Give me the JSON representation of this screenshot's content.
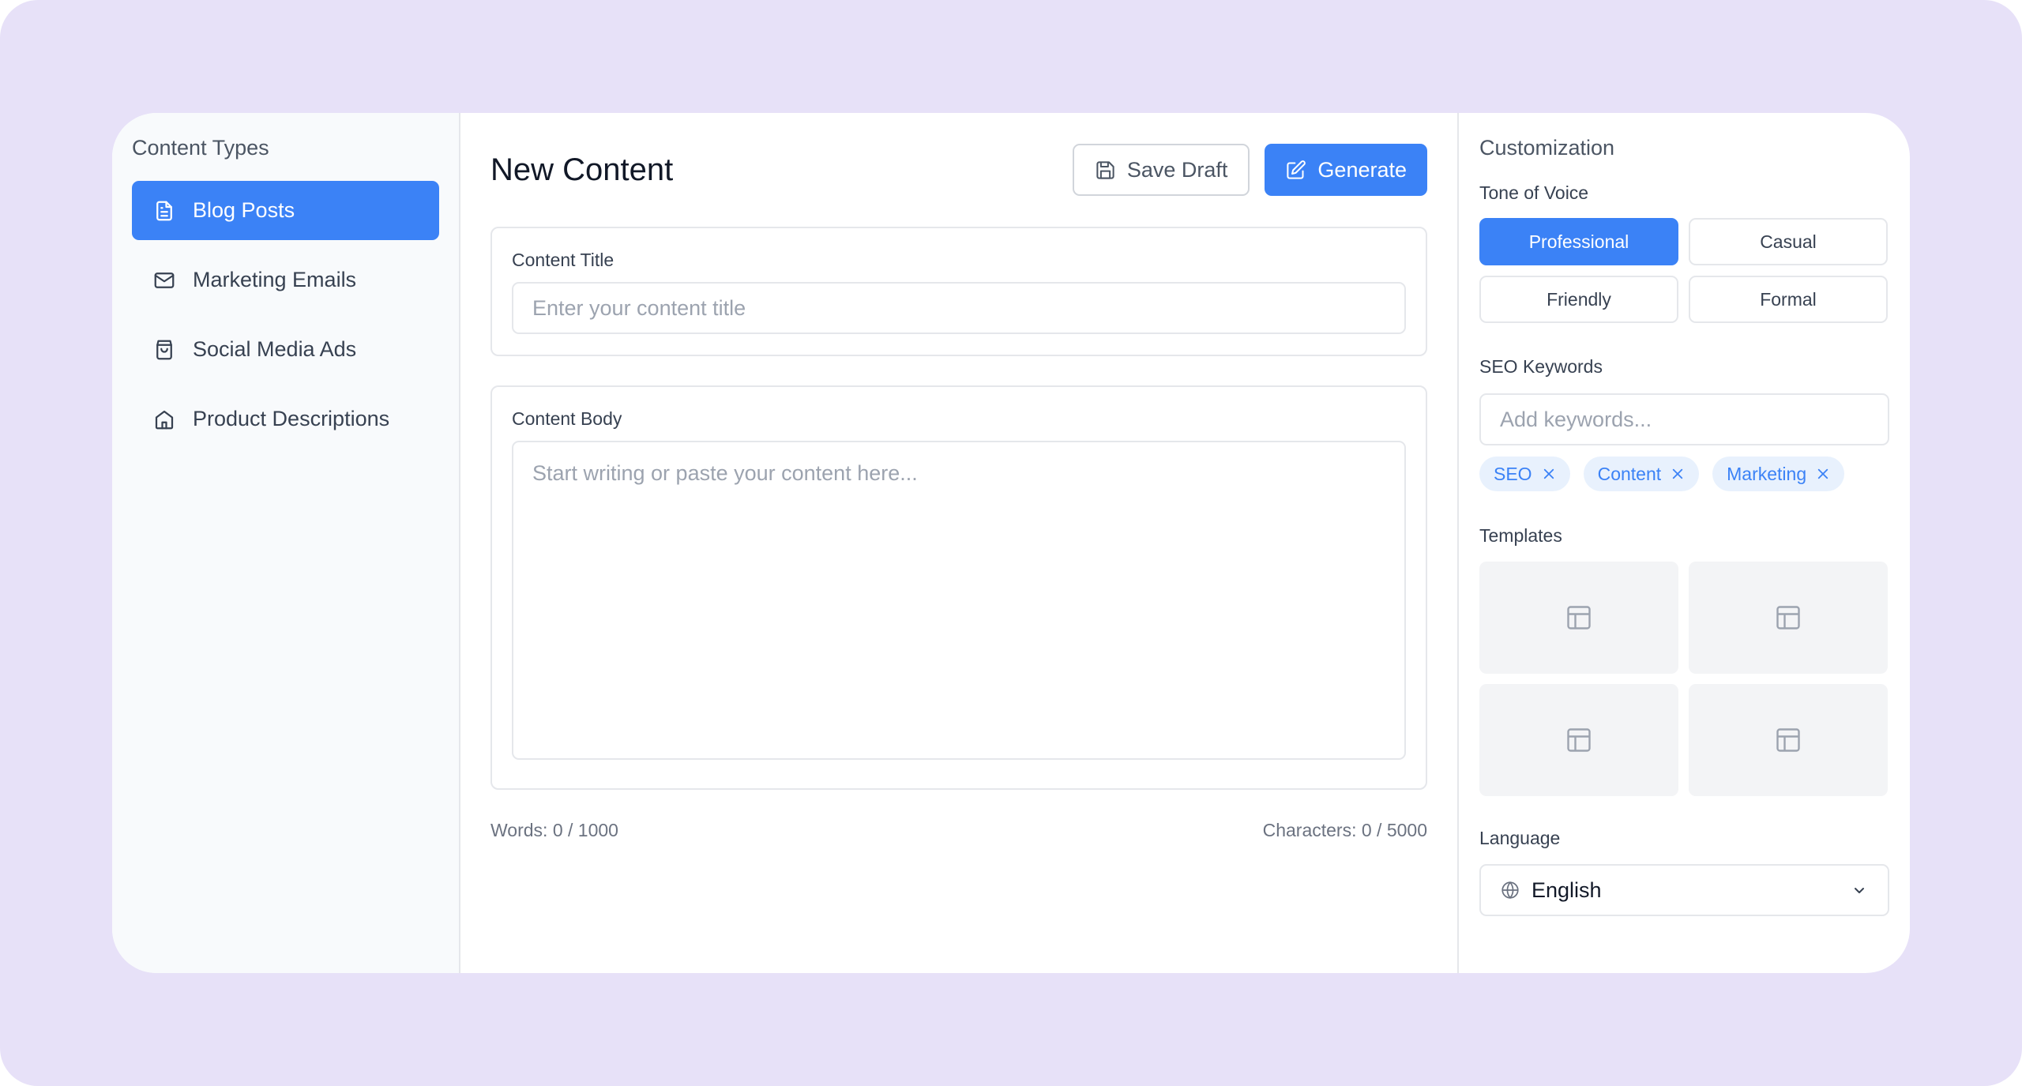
{
  "sidebar": {
    "title": "Content Types",
    "items": [
      {
        "label": "Blog Posts",
        "icon": "document-icon",
        "active": true
      },
      {
        "label": "Marketing Emails",
        "icon": "mail-icon",
        "active": false
      },
      {
        "label": "Social Media Ads",
        "icon": "shopping-bag-icon",
        "active": false
      },
      {
        "label": "Product Descriptions",
        "icon": "home-icon",
        "active": false
      }
    ]
  },
  "main": {
    "title": "New Content",
    "save_draft_label": "Save Draft",
    "generate_label": "Generate",
    "content_title_label": "Content Title",
    "content_title_placeholder": "Enter your content title",
    "content_title_value": "",
    "content_body_label": "Content Body",
    "content_body_placeholder": "Start writing or paste your content here...",
    "content_body_value": "",
    "words_count": "Words: 0 / 1000",
    "characters_count": "Characters: 0 / 5000"
  },
  "customization": {
    "title": "Customization",
    "tone_label": "Tone of Voice",
    "tones": [
      {
        "label": "Professional",
        "active": true
      },
      {
        "label": "Casual",
        "active": false
      },
      {
        "label": "Friendly",
        "active": false
      },
      {
        "label": "Formal",
        "active": false
      }
    ],
    "seo_label": "SEO Keywords",
    "seo_placeholder": "Add keywords...",
    "keywords": [
      "SEO",
      "Content",
      "Marketing"
    ],
    "templates_label": "Templates",
    "templates_icon": "layout-template-icon",
    "language_label": "Language",
    "language_value": "English"
  },
  "colors": {
    "accent": "#3b82f6",
    "background": "#e7e1f8",
    "sidebar_bg": "#f8fafc",
    "tag_bg": "#e8f1fd"
  }
}
